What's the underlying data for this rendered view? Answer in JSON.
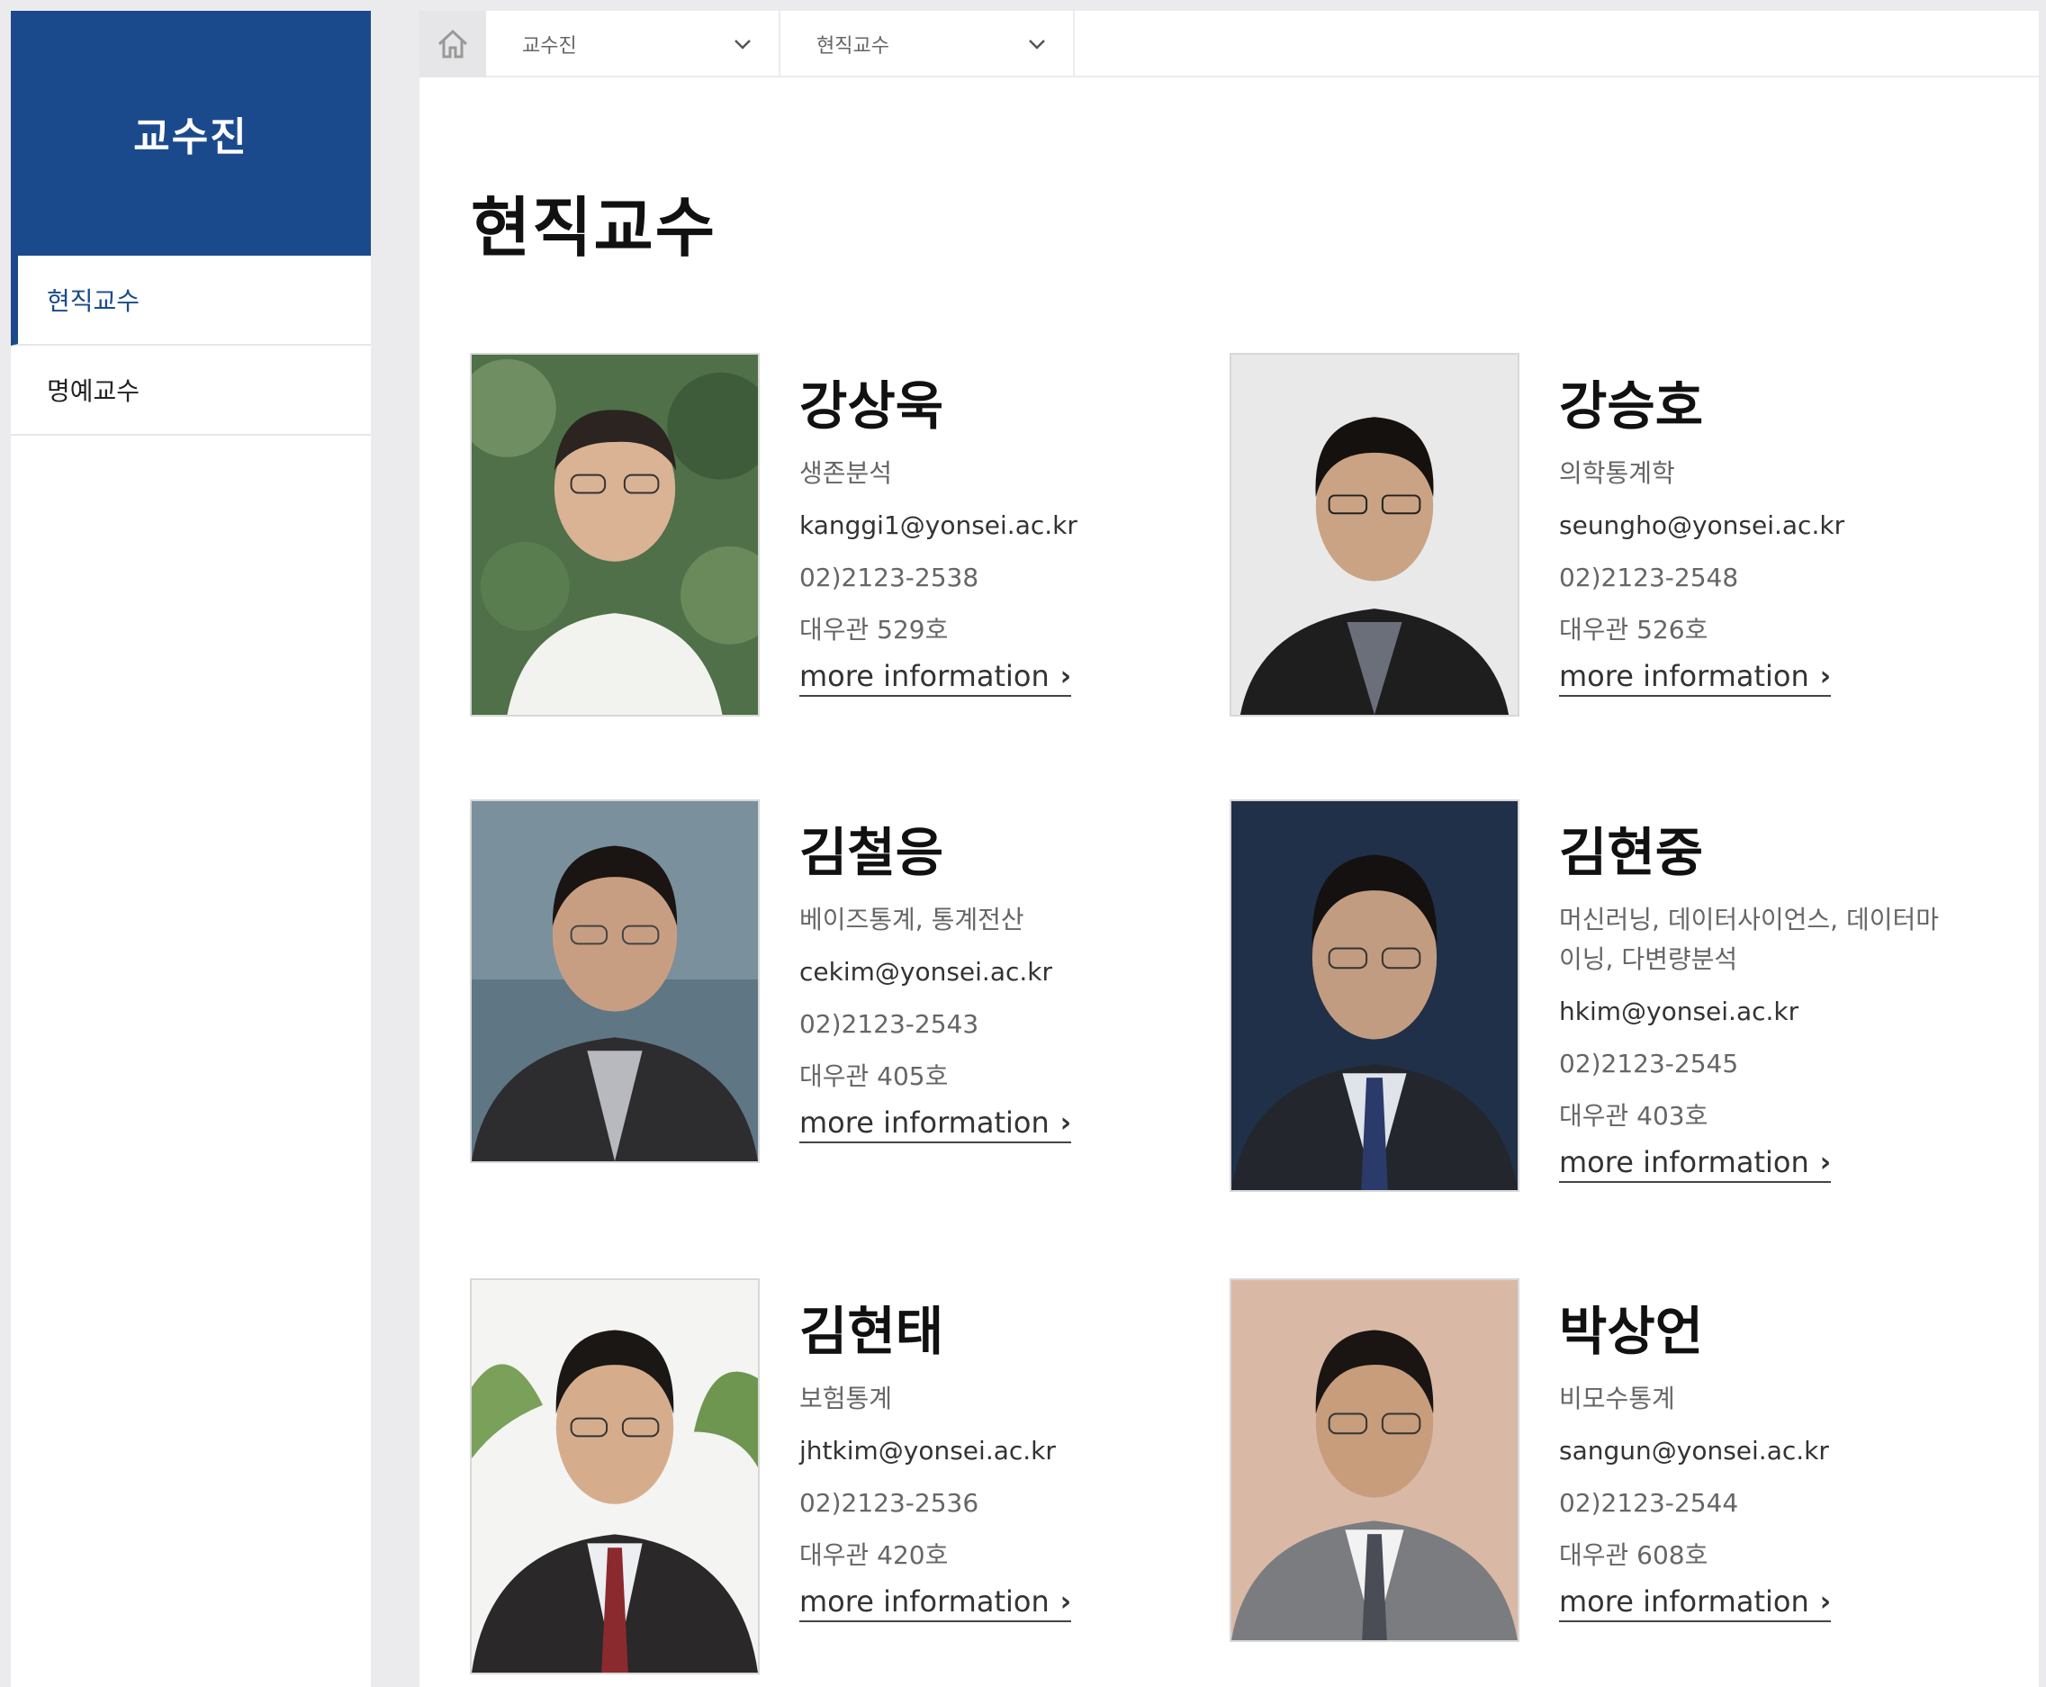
{
  "sidebar": {
    "title": "교수진",
    "items": [
      {
        "label": "현직교수",
        "active": true
      },
      {
        "label": "명예교수",
        "active": false
      }
    ]
  },
  "breadcrumb": {
    "home_icon": "home-icon",
    "level1": "교수진",
    "level2": "현직교수"
  },
  "page": {
    "title": "현직교수"
  },
  "more_label": "more information",
  "colors": {
    "brand": "#1b4a8c",
    "background": "#ebebee"
  },
  "professors": [
    {
      "name": "강상욱",
      "field": "생존분석",
      "email": "kanggi1@yonsei.ac.kr",
      "phone": "02)2123-2538",
      "office": "대우관 529호"
    },
    {
      "name": "강승호",
      "field": "의학통계학",
      "email": "seungho@yonsei.ac.kr",
      "phone": "02)2123-2548",
      "office": "대우관 526호"
    },
    {
      "name": "김철응",
      "field": "베이즈통계, 통계전산",
      "email": "cekim@yonsei.ac.kr",
      "phone": "02)2123-2543",
      "office": "대우관 405호"
    },
    {
      "name": "김현중",
      "field": "머신러닝, 데이터사이언스, 데이터마이닝, 다변량분석",
      "email": "hkim@yonsei.ac.kr",
      "phone": "02)2123-2545",
      "office": "대우관 403호"
    },
    {
      "name": "김현태",
      "field": "보험통계",
      "email": "jhtkim@yonsei.ac.kr",
      "phone": "02)2123-2536",
      "office": "대우관 420호"
    },
    {
      "name": "박상언",
      "field": "비모수통계",
      "email": "sangun@yonsei.ac.kr",
      "phone": "02)2123-2544",
      "office": "대우관 608호"
    }
  ]
}
